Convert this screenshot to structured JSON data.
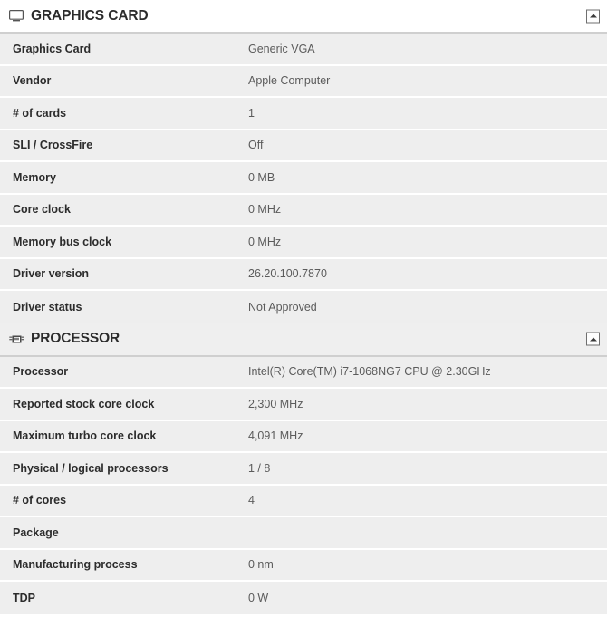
{
  "sections": [
    {
      "id": "graphics-card",
      "title": "GRAPHICS CARD",
      "icon": "monitor-icon",
      "header_style": "white",
      "collapse_label": "collapse",
      "rows": [
        {
          "label": "Graphics Card",
          "value": "Generic VGA"
        },
        {
          "label": "Vendor",
          "value": "Apple Computer"
        },
        {
          "label": "# of cards",
          "value": "1"
        },
        {
          "label": "SLI / CrossFire",
          "value": "Off"
        },
        {
          "label": "Memory",
          "value": "0 MB"
        },
        {
          "label": "Core clock",
          "value": "0 MHz"
        },
        {
          "label": "Memory bus clock",
          "value": "0 MHz"
        },
        {
          "label": "Driver version",
          "value": "26.20.100.7870"
        },
        {
          "label": "Driver status",
          "value": "Not Approved"
        }
      ]
    },
    {
      "id": "processor",
      "title": "PROCESSOR",
      "icon": "cpu-chip-icon",
      "header_style": "gray",
      "collapse_label": "collapse",
      "rows": [
        {
          "label": "Processor",
          "value": "Intel(R) Core(TM) i7-1068NG7 CPU @ 2.30GHz"
        },
        {
          "label": "Reported stock core clock",
          "value": "2,300 MHz"
        },
        {
          "label": "Maximum turbo core clock",
          "value": "4,091 MHz"
        },
        {
          "label": "Physical / logical processors",
          "value": "1 / 8"
        },
        {
          "label": "# of cores",
          "value": "4"
        },
        {
          "label": "Package",
          "value": ""
        },
        {
          "label": "Manufacturing process",
          "value": "0 nm"
        },
        {
          "label": "TDP",
          "value": "0 W"
        }
      ]
    }
  ],
  "colors": {
    "row_background": "#eeeeee",
    "row_separator": "#ffffff",
    "header_separator": "#cfcfcf",
    "label_text": "#2c2c2c",
    "value_text": "#5b5b5b",
    "header_gray": "#efefef"
  }
}
